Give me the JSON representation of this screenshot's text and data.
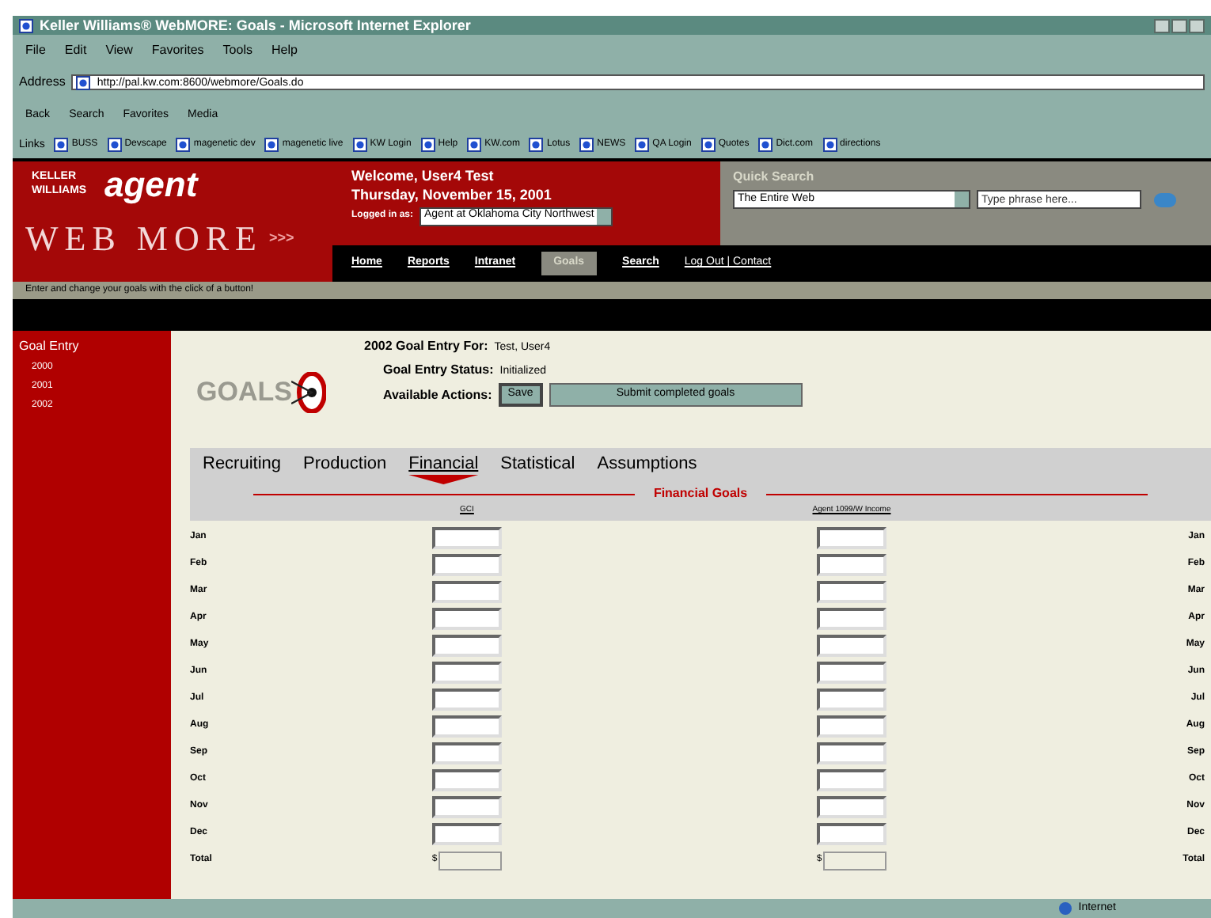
{
  "window": {
    "title": "Keller Williams® WebMORE: Goals - Microsoft Internet Explorer"
  },
  "menu": [
    "File",
    "Edit",
    "View",
    "Favorites",
    "Tools",
    "Help"
  ],
  "address": {
    "label": "Address",
    "url": "http://pal.kw.com:8600/webmore/Goals.do"
  },
  "toolbar": [
    "Back",
    "Search",
    "Favorites",
    "Media"
  ],
  "links": {
    "label": "Links",
    "items": [
      "BUSS",
      "Devscape",
      "magenetic dev",
      "magenetic live",
      "KW Login",
      "Help",
      "KW.com",
      "Lotus",
      "NEWS",
      "QA Login",
      "Quotes",
      "Dict.com",
      "directions"
    ]
  },
  "header": {
    "brand": "KELLER WILLIAMS",
    "agent": "agent",
    "webmore": "WEB MORE",
    "arrows": ">>>",
    "welcome": "Welcome, User4 Test",
    "date": "Thursday, November 15, 2001",
    "logged_label": "Logged in as:",
    "logged_value": "Agent at Oklahoma City Northwest"
  },
  "quick_search": {
    "title": "Quick Search",
    "scope": "The Entire Web",
    "placeholder": "Type phrase here..."
  },
  "nav": [
    {
      "label": "Home",
      "selected": false
    },
    {
      "label": "Reports",
      "selected": false
    },
    {
      "label": "Intranet",
      "selected": false
    },
    {
      "label": "Goals",
      "selected": true
    },
    {
      "label": "Search",
      "selected": false
    }
  ],
  "nav_links": "Log Out | Contact",
  "hint": "Enter and change your goals with the click of a button!",
  "sidebar": {
    "title": "Goal Entry",
    "items": [
      "2000",
      "2001",
      "2002"
    ]
  },
  "goals": {
    "logo": "GOALS",
    "entry_label": "2002 Goal Entry For:",
    "entry_value": "Test, User4",
    "status_label": "Goal Entry Status:",
    "status_value": "Initialized",
    "actions_label": "Available Actions:",
    "actions": [
      "Save",
      "Submit completed goals"
    ]
  },
  "tabs": [
    {
      "label": "Recruiting",
      "selected": false
    },
    {
      "label": "Production",
      "selected": false
    },
    {
      "label": "Financial",
      "selected": true
    },
    {
      "label": "Statistical",
      "selected": false
    },
    {
      "label": "Assumptions",
      "selected": false
    }
  ],
  "section_title": "Financial Goals",
  "table": {
    "columns": [
      "GCI",
      "Agent 1099/W Income"
    ],
    "rows": [
      {
        "label": "Jan",
        "right_label": "Jan",
        "kind": "month"
      },
      {
        "label": "Feb",
        "right_label": "Feb",
        "kind": "month"
      },
      {
        "label": "Mar",
        "right_label": "Mar",
        "kind": "month"
      },
      {
        "label": "Apr",
        "right_label": "Apr",
        "kind": "month"
      },
      {
        "label": "May",
        "right_label": "May",
        "kind": "month"
      },
      {
        "label": "Jun",
        "right_label": "Jun",
        "kind": "month"
      },
      {
        "label": "Jul",
        "right_label": "Jul",
        "kind": "month"
      },
      {
        "label": "Aug",
        "right_label": "Aug",
        "kind": "month"
      },
      {
        "label": "Sep",
        "right_label": "Sep",
        "kind": "month"
      },
      {
        "label": "Oct",
        "right_label": "Oct",
        "kind": "month"
      },
      {
        "label": "Nov",
        "right_label": "Nov",
        "kind": "month"
      },
      {
        "label": "Dec",
        "right_label": "Dec",
        "kind": "month"
      },
      {
        "label": "Total",
        "right_label": "Total",
        "kind": "total",
        "prefix": "$"
      }
    ]
  },
  "status_bar": {
    "zone": "Internet"
  }
}
